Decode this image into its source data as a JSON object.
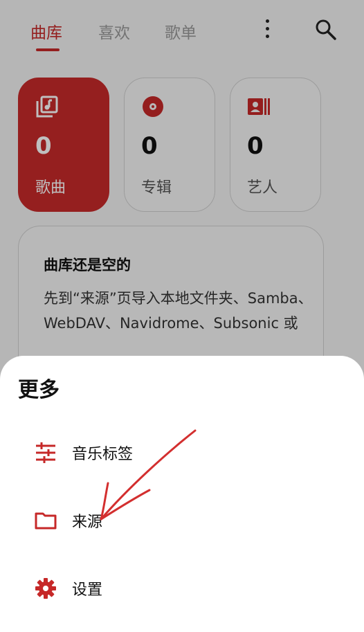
{
  "tabs": [
    {
      "label": "曲库",
      "active": true
    },
    {
      "label": "喜欢",
      "active": false
    },
    {
      "label": "歌单",
      "active": false
    }
  ],
  "toolbar": {
    "more_icon": "more-vert-icon",
    "search_icon": "search-icon"
  },
  "stats": [
    {
      "icon": "music-library-icon",
      "value": "0",
      "label": "歌曲",
      "active": true
    },
    {
      "icon": "album-disc-icon",
      "value": "0",
      "label": "专辑",
      "active": false
    },
    {
      "icon": "artist-card-icon",
      "value": "0",
      "label": "艺人",
      "active": false
    }
  ],
  "empty_state": {
    "title": "曲库还是空的",
    "body": "先到“来源”页导入本地文件夹、Samba、WebDAV、Navidrome、Subsonic 或"
  },
  "sheet": {
    "title": "更多",
    "items": [
      {
        "icon": "tune-sliders-icon",
        "label": "音乐标签"
      },
      {
        "icon": "folder-icon",
        "label": "来源"
      },
      {
        "icon": "settings-gear-icon",
        "label": "设置"
      }
    ]
  },
  "colors": {
    "accent": "#c62828",
    "card_active": "#c72a2a",
    "annotation_arrow": "#d32f2f"
  }
}
